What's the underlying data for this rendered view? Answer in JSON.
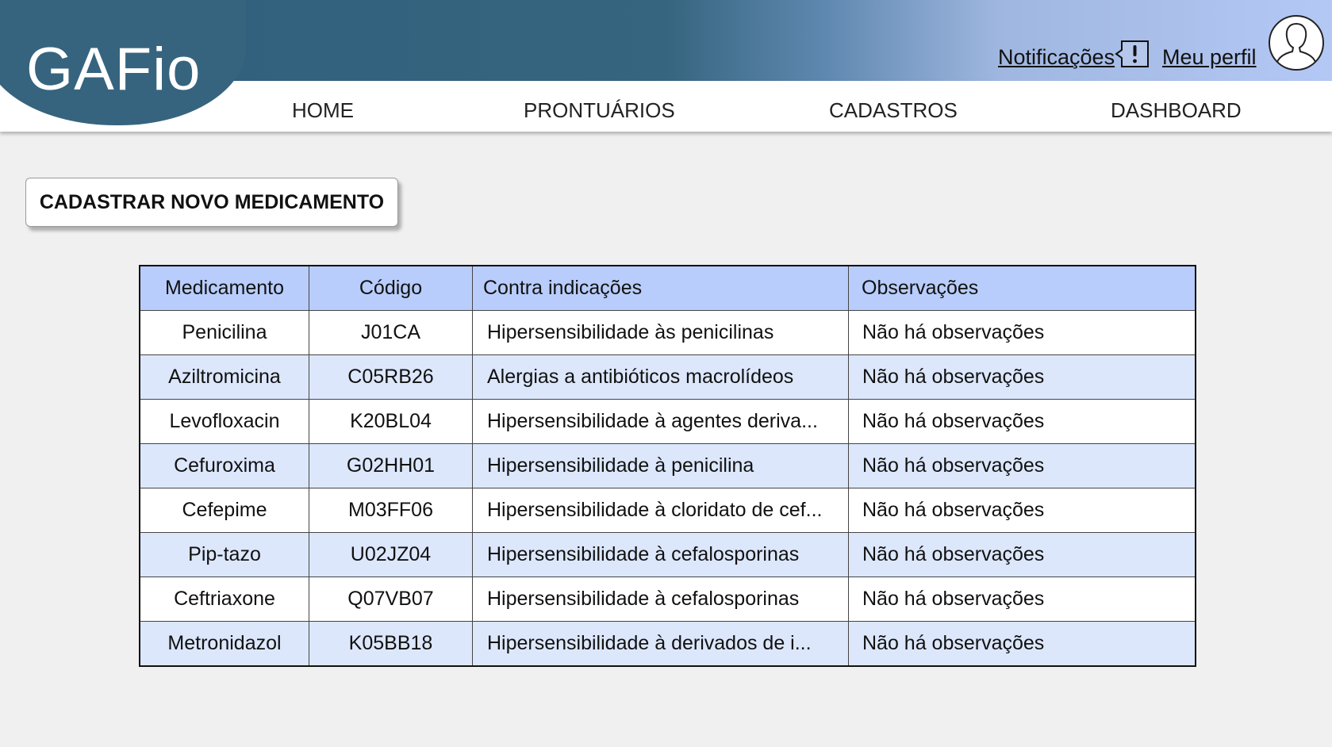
{
  "app": {
    "logo": "GAFio"
  },
  "header": {
    "notifications_label": "Notificações",
    "profile_label": "Meu perfil",
    "colors": {
      "header_dark": "#36647f",
      "header_light": "#b4c8f5"
    }
  },
  "nav": {
    "home": "HOME",
    "records": "PRONTUÁRIOS",
    "registrations": "CADASTROS",
    "dashboard": "DASHBOARD"
  },
  "actions": {
    "new_medication": "CADASTRAR NOVO MEDICAMENTO"
  },
  "table": {
    "headers": [
      "Medicamento",
      "Código",
      "Contra indicações",
      "Observações"
    ],
    "rows": [
      [
        "Penicilina",
        "J01CA",
        "Hipersensibilidade às penicilinas",
        "Não há observações"
      ],
      [
        "Aziltromicina",
        "C05RB26",
        "Alergias a antibióticos macrolídeos",
        "Não há observações"
      ],
      [
        "Levofloxacin",
        "K20BL04",
        "Hipersensibilidade à agentes deriva...",
        "Não há observações"
      ],
      [
        "Cefuroxima",
        "G02HH01",
        "Hipersensibilidade à penicilina",
        "Não há observações"
      ],
      [
        "Cefepime",
        "M03FF06",
        "Hipersensibilidade à cloridato de cef...",
        "Não há observações"
      ],
      [
        "Pip-tazo",
        "U02JZ04",
        "Hipersensibilidade à cefalosporinas",
        "Não há observações"
      ],
      [
        "Ceftriaxone",
        "Q07VB07",
        "Hipersensibilidade à cefalosporinas",
        "Não há observações"
      ],
      [
        "Metronidazol",
        "K05BB18",
        "Hipersensibilidade à derivados de i...",
        "Não há observações"
      ]
    ],
    "colors": {
      "header_bg": "#b8cdfb",
      "alt_row_bg": "#dce7fc"
    }
  },
  "icons": {
    "notification": "alert-speech-bubble-icon",
    "profile": "user-avatar-icon"
  }
}
